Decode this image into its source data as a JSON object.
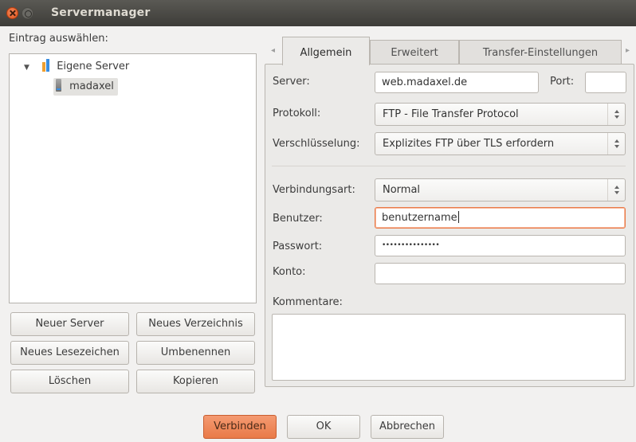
{
  "window": {
    "title": "Servermanager"
  },
  "left": {
    "select_entry_label": "Eintrag auswählen:",
    "tree": {
      "expander": "▼",
      "group_label": "Eigene Server",
      "server_label": "madaxel"
    },
    "buttons": {
      "new_server": "Neuer Server",
      "new_folder": "Neues Verzeichnis",
      "new_bookmark": "Neues Lesezeichen",
      "rename": "Umbenennen",
      "delete": "Löschen",
      "copy": "Kopieren"
    }
  },
  "tabs": {
    "general": "Allgemein",
    "advanced": "Erweitert",
    "transfer": "Transfer-Einstellungen",
    "scroll_left": "◂",
    "scroll_right": "▸"
  },
  "form": {
    "server_label": "Server:",
    "server_value": "web.madaxel.de",
    "port_label": "Port:",
    "port_value": "",
    "protocol_label": "Protokoll:",
    "protocol_value": "FTP - File Transfer Protocol",
    "encryption_label": "Verschlüsselung:",
    "encryption_value": "Explizites FTP über TLS erfordern",
    "logon_type_label": "Verbindungsart:",
    "logon_type_value": "Normal",
    "user_label": "Benutzer:",
    "user_value": "benutzername",
    "password_label": "Passwort:",
    "password_value": "•••••••••••••••",
    "account_label": "Konto:",
    "account_value": "",
    "comments_label": "Kommentare:"
  },
  "footer": {
    "connect": "Verbinden",
    "ok": "OK",
    "cancel": "Abbrechen"
  },
  "colors": {
    "accent": "#e97a48",
    "titlebar": "#3d3c38",
    "background": "#f2f1f0"
  }
}
